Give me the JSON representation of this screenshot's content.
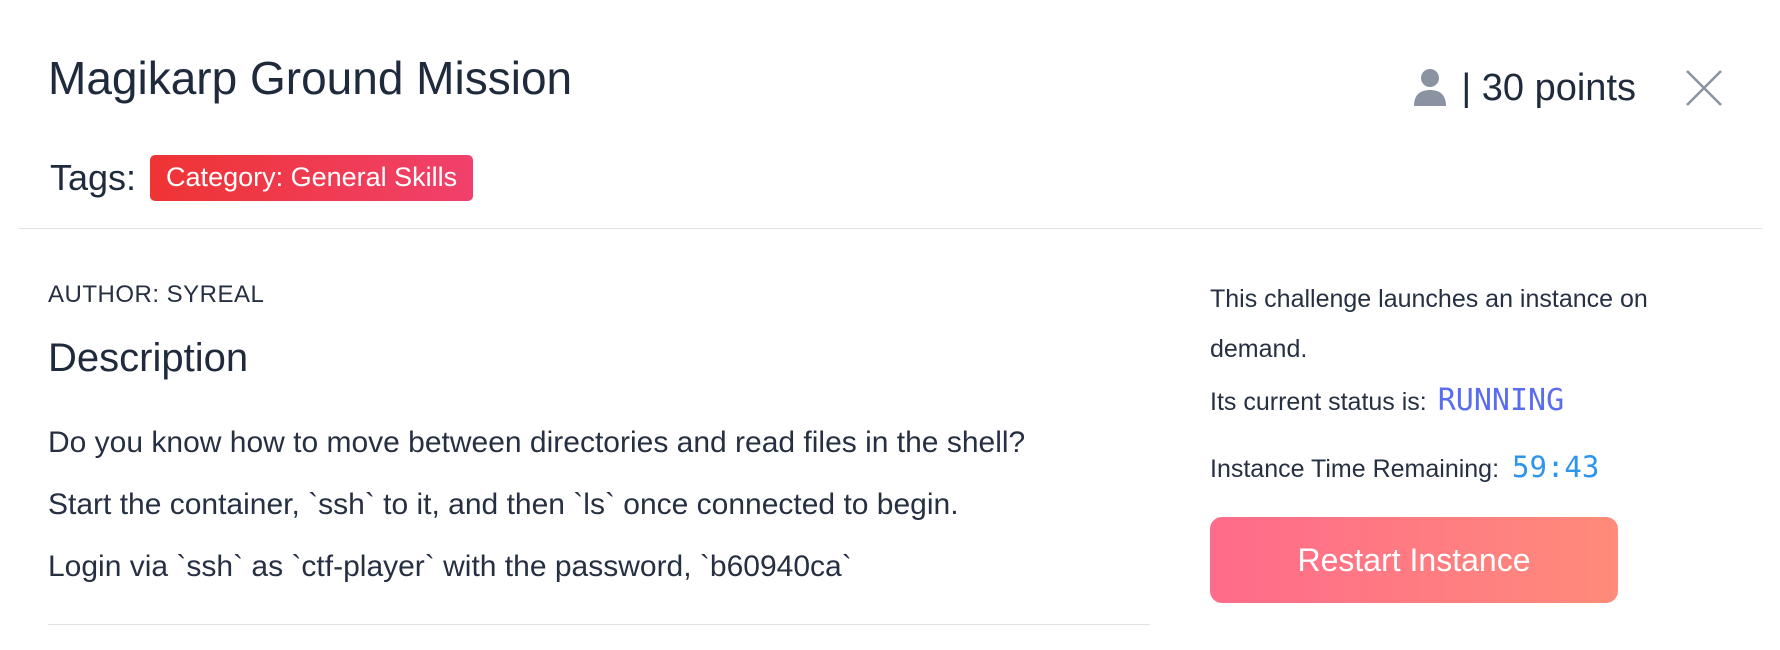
{
  "header": {
    "title": "Magikarp Ground Mission",
    "points_text": "| 30 points",
    "icons": {
      "user": "user-icon",
      "close": "close-icon"
    }
  },
  "tags": {
    "label": "Tags:",
    "items": [
      "Category: General Skills"
    ]
  },
  "description": {
    "author": "AUTHOR: SYREAL",
    "heading": "Description",
    "lines": [
      "Do you know how to move between directories and read files in the shell?",
      "Start the container, `ssh` to it, and then `ls` once connected to begin.",
      "Login via `ssh` as `ctf-player` with the password, `b60940ca`"
    ]
  },
  "instance": {
    "intro": "This challenge launches an instance on demand.",
    "status_label": "Its current status is:",
    "status_value": "RUNNING",
    "time_label": "Instance Time Remaining:",
    "time_value": "59:43",
    "restart_label": "Restart Instance"
  },
  "colors": {
    "tag_bg_start": "#ef3434",
    "tag_bg_end": "#f0416c",
    "status": "#5a6cf0",
    "timer": "#2e95ee",
    "button_start": "#ff6b8a",
    "button_end": "#ff8b7a"
  }
}
